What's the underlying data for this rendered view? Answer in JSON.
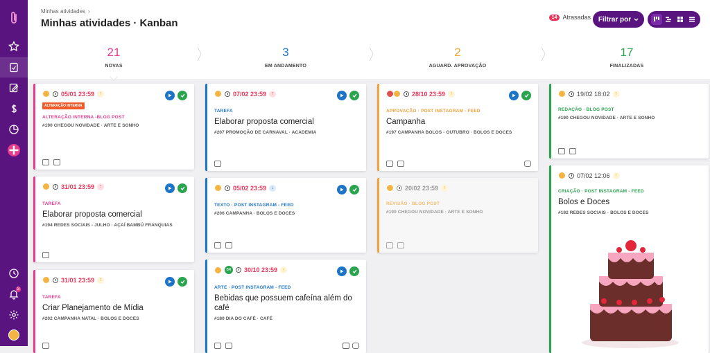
{
  "page": {
    "breadcrumb": "Minhas atividades",
    "title": "Minhas atividades · Kanban"
  },
  "header": {
    "late_count": "14",
    "late_label": "Atrasadas",
    "filter_label": "Filtrar por"
  },
  "colors": {
    "brand": "#5a1480",
    "pink": "#e53c8e",
    "blue": "#1e75c8",
    "orange": "#f0a23b",
    "green": "#2aa44f",
    "red": "#e8375a"
  },
  "columns": [
    {
      "count": "21",
      "label": "NOVAS",
      "color": "#e53c8e"
    },
    {
      "count": "3",
      "label": "EM ANDAMENTO",
      "color": "#1e75c8"
    },
    {
      "count": "2",
      "label": "AGUARD. APROVAÇÃO",
      "color": "#f0a23b"
    },
    {
      "count": "17",
      "label": "FINALIZADAS",
      "color": "#2aa44f"
    }
  ],
  "cards": {
    "c1": {
      "date": "05/01 23:59",
      "tag": "ALTERAÇÃO INTERNA",
      "type": "ALTERAÇÃO INTERNA -BLOG POST",
      "sub": "#190 CHEGOU NOVIDADE · ARTE E SONHO"
    },
    "c2": {
      "date": "31/01 23:59",
      "type": "TAREFA",
      "title": "Elaborar proposta comercial",
      "sub": "#194 REDES SOCIAIS - JULHO · AÇAÍ BAMBÚ FRANQUIAS"
    },
    "c3": {
      "date": "31/01 23:59",
      "type": "TAREFA",
      "title": "Criar Planejamento de Mídia",
      "sub": "#202 CAMPANHA NATAL · BOLOS E DOCES"
    },
    "c4": {
      "date": "07/02 23:59",
      "type": "TAREFA",
      "title": "Elaborar proposta comercial",
      "sub": "#207 PROMOÇÃO DE CARNAVAL · ACADEMIA"
    },
    "c5": {
      "date": "05/02 23:59",
      "type": "TEXTO · POST INSTAGRAM - FEED",
      "sub": "#206 CAMPANHA · BOLOS E DOCES"
    },
    "c6": {
      "date": "30/10 23:59",
      "av_initials": "BR",
      "type": "ARTE · POST INSTAGRAM - FEED",
      "title": "Bebidas que possuem cafeína além do café",
      "sub": "#180 DIA DO CAFÉ · CAFÉ"
    },
    "c7": {
      "date": "28/10 23:59",
      "type": "APROVAÇÃO · POST INSTAGRAM - FEED",
      "title": "Campanha",
      "sub": "#197 CAMPANHA BOLOS - OUTUBRO · BOLOS E DOCES"
    },
    "c8": {
      "date": "20/02 23:59",
      "type": "REVISÃO · BLOG POST",
      "sub": "#190 CHEGOU NOVIDADE · ARTE E SONHO"
    },
    "c9": {
      "date": "19/02 18:02",
      "type": "REDAÇÃO · BLOG POST",
      "sub": "#190 CHEGOU NOVIDADE · ARTE E SONHO"
    },
    "c10": {
      "date": "07/02 12:06",
      "type": "CRIAÇÃO · POST INSTAGRAM - FEED",
      "title": "Bolos e Doces",
      "sub": "#192 REDES SOCIAIS · BOLOS E DOCES"
    }
  },
  "sidebar": {
    "notification_count": "3"
  }
}
